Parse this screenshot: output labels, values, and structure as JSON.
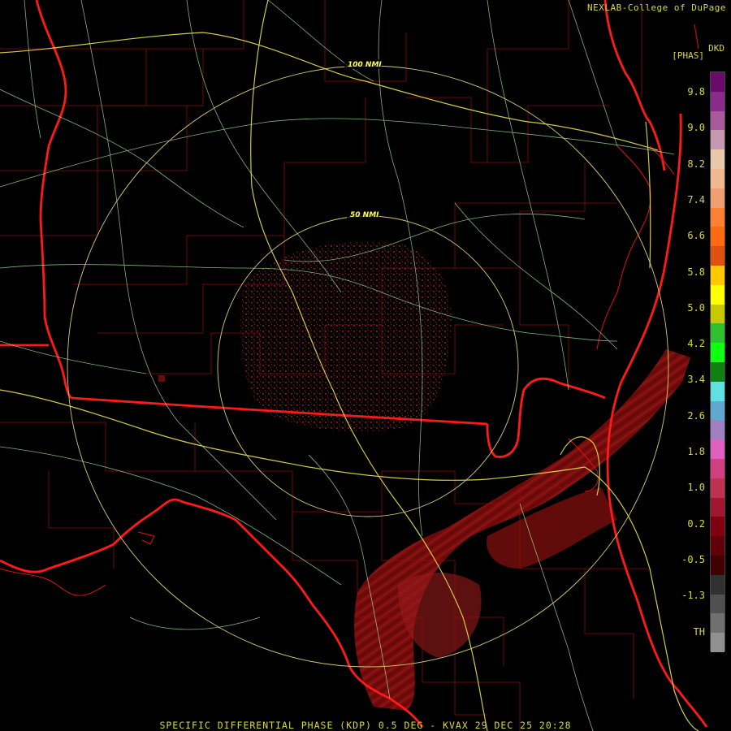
{
  "credit": "NEXLAB-College of DuPage",
  "product_code": "DKD",
  "units": "[PHAS]",
  "footer": "SPECIFIC DIFFERENTIAL PHASE (KDP) 0.5 DEG - KVAX 29 DEC 25 20:28",
  "range_rings": [
    {
      "label": "100 NMI"
    },
    {
      "label": "50 NMI"
    }
  ],
  "legend": {
    "ticks": [
      "9.8",
      "9.0",
      "8.2",
      "7.4",
      "6.6",
      "5.8",
      "5.0",
      "4.2",
      "3.4",
      "2.6",
      "1.8",
      "1.0",
      "0.2",
      "-0.5",
      "-1.3",
      "TH"
    ],
    "colors": [
      "#6a0a6a",
      "#8a2a8a",
      "#a85a9a",
      "#c898b0",
      "#e8c8a8",
      "#f0b890",
      "#f0a070",
      "#ff8030",
      "#ff6a10",
      "#e05010",
      "#ffc800",
      "#ffff00",
      "#c8c800",
      "#30c030",
      "#10ff10",
      "#108010",
      "#60e0e0",
      "#60a8d0",
      "#a080c0",
      "#e060c0",
      "#d04080",
      "#c03050",
      "#a01830",
      "#800010",
      "#600008",
      "#400000",
      "#303030",
      "#505050",
      "#707070",
      "#909090"
    ]
  }
}
